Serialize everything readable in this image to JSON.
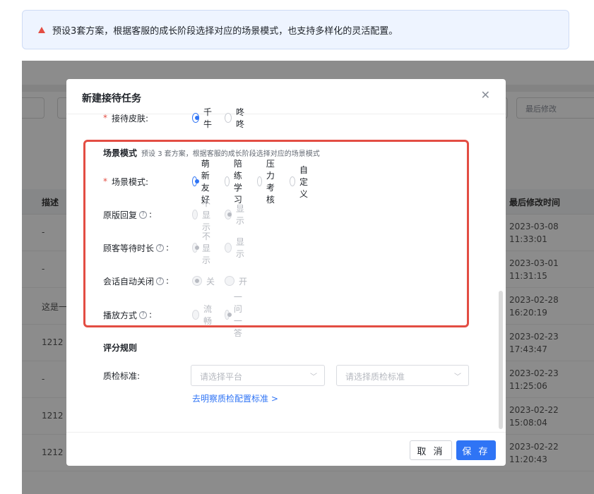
{
  "banner": {
    "text": "预设3套方案，根据客服的成长阶段选择对应的场景模式，也支持多样化的灵活配置。"
  },
  "background": {
    "toolbar_last_box": "最后修改",
    "columns": {
      "desc": "描述",
      "modified": "最后修改时间"
    },
    "rows": [
      {
        "desc": "-",
        "time": "2023-03-08\n11:33:01"
      },
      {
        "desc": "-",
        "time": "2023-03-01\n11:31:15"
      },
      {
        "desc": "这是一",
        "time": "2023-02-28\n16:20:19"
      },
      {
        "desc": "1212",
        "time": "2023-02-23\n17:43:47"
      },
      {
        "desc": "-",
        "time": "2023-02-23\n11:25:06"
      },
      {
        "desc": "1212",
        "time": "2023-02-22\n15:08:04"
      },
      {
        "desc": "1212",
        "time": "2023-02-22\n11:20:43"
      }
    ]
  },
  "modal": {
    "title": "新建接待任务",
    "close_icon": "close-icon",
    "skin": {
      "label": "接待皮肤:",
      "options": [
        "千牛",
        "咚咚"
      ],
      "selected": 0
    },
    "scene_section": {
      "title": "场景模式",
      "hint": "预设 3 套方案，根据客服的成长阶段选择对应的场景模式"
    },
    "scene_mode": {
      "label": "场景模式:",
      "options": [
        "萌新友好",
        "陪练学习",
        "压力考核",
        "自定义"
      ],
      "selected": 0
    },
    "original_reply": {
      "label": "原版回复",
      "options": [
        "不显示",
        "显示"
      ],
      "selected": 1
    },
    "wait_time": {
      "label": "顾客等待时长",
      "options": [
        "不显示",
        "显示"
      ],
      "selected": 0
    },
    "auto_close": {
      "label": "会话自动关闭",
      "options": [
        "关",
        "开"
      ],
      "selected": 0
    },
    "play_mode": {
      "label": "播放方式",
      "options": [
        "流畅",
        "一问一答"
      ],
      "selected": 1
    },
    "scoring": {
      "title": "评分规则"
    },
    "qc": {
      "label": "质检标准:",
      "platform_placeholder": "请选择平台",
      "standard_placeholder": "请选择质检标准",
      "link": "去明察质检配置标准 >"
    },
    "footer": {
      "cancel": "取 消",
      "save": "保 存"
    }
  },
  "colors": {
    "accent": "#2f74f5",
    "required": "#e34d43",
    "highlight": "#e34d43"
  }
}
